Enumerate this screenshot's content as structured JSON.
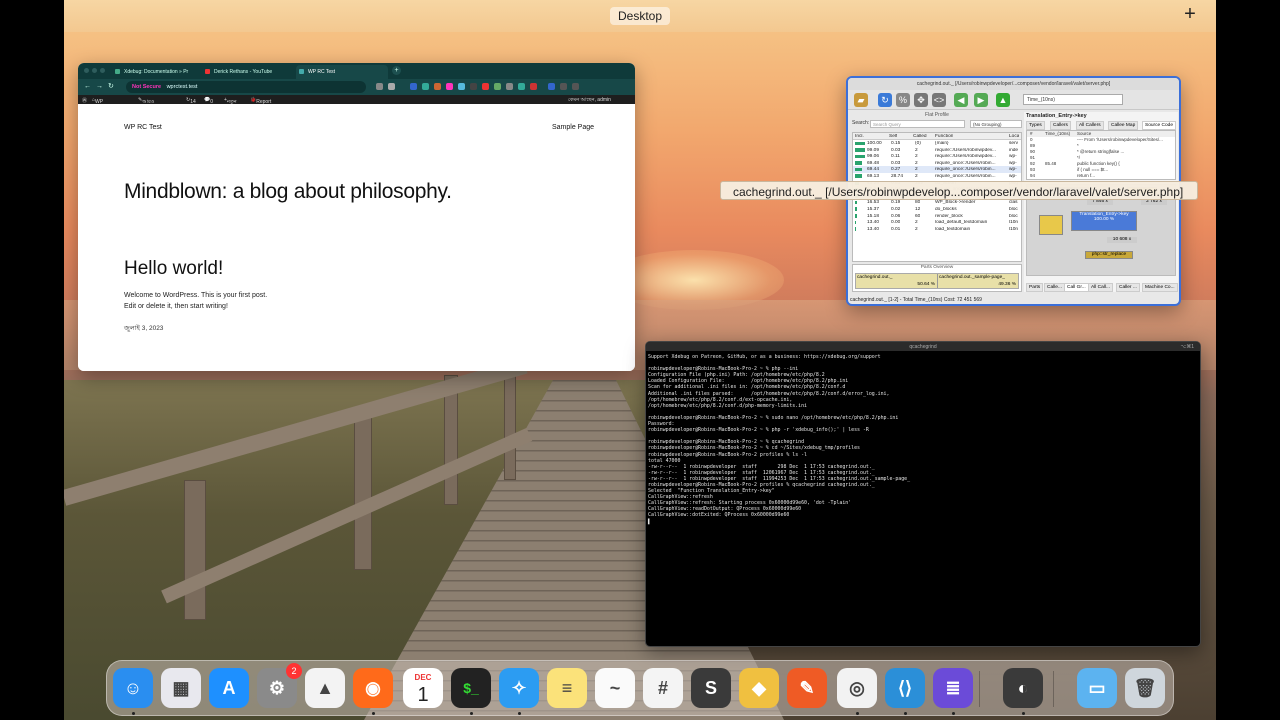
{
  "menubar": {
    "desktop_label": "Desktop",
    "plus_label": "+"
  },
  "browser": {
    "tabs": [
      {
        "label": "Xdebug: Documentation » Pr",
        "color": "#4a8"
      },
      {
        "label": "Derick Rethans - YouTube",
        "color": "#e33"
      },
      {
        "label": "WP RC Test",
        "color": "#4aa"
      }
    ],
    "new_tab": "+",
    "url_not_secure": "Not Secure",
    "url": "wprctest.test",
    "admin_bar": {
      "site": "WP RC Test",
      "customize": "আরও কাস্টমাইজ",
      "updates": "14",
      "comments": "0",
      "new": "নতুন",
      "report": "Report a Bug",
      "howdy": "কেমন আছেন, admin"
    },
    "page": {
      "site_title": "WP RC Test",
      "nav_link": "Sample Page",
      "hero": "Mindblown: a blog about philosophy.",
      "post_title": "Hello world!",
      "post_line1": "Welcome to WordPress. This is your first post.",
      "post_line2": "Edit or delete it, then start writing!",
      "post_date": "জুলাই 3, 2023"
    }
  },
  "kcachegrind": {
    "title": "cachegrind.out._ [/Users/robinwpdeveloper/...composer/vendor/laravel/valet/server.php]",
    "event_select": "Time_(10ns)",
    "flat_profile_label": "Flat Profile",
    "search_label": "Search:",
    "search_placeholder": "Search Query",
    "grouping": "(No Grouping)",
    "columns": [
      "Incl.",
      "Self",
      "Called",
      "Function",
      "Loca"
    ],
    "rows": [
      {
        "incl": "100.00",
        "self": "0.15",
        "called": "(0)",
        "fn": "{main}",
        "loc": "serv"
      },
      {
        "incl": "99.09",
        "self": "0.03",
        "called": "2",
        "fn": "require::/Users/robinwpdev...",
        "loc": "inde"
      },
      {
        "incl": "99.06",
        "self": "0.11",
        "called": "2",
        "fn": "require::/Users/robinwpdev...",
        "loc": "wp-"
      },
      {
        "incl": "69.48",
        "self": "0.03",
        "called": "2",
        "fn": "require_once::/Users/robin...",
        "loc": "wp-"
      },
      {
        "incl": "69.44",
        "self": "0.27",
        "called": "2",
        "fn": "require_once::/Users/robin...",
        "loc": "wp-"
      },
      {
        "incl": "69.13",
        "self": "28.74",
        "called": "2",
        "fn": "require_once::/Users/robin...",
        "loc": "wp-"
      },
      {
        "incl": "43.28",
        "self": "0.63",
        "called": "382",
        "fn": "do_action",
        "loc": "plug"
      },
      {
        "incl": "28.23",
        "self": "0.04",
        "called": "2",
        "fn": "require_once::/Users/robin...",
        "loc": "tem"
      },
      {
        "incl": "25.06",
        "self": "0.01",
        "called": "2",
        "fn": "include::/Users/robinwpdev...",
        "loc": "tem"
      },
      {
        "incl": "16.53",
        "self": "0.19",
        "called": "80",
        "fn": "WP_Block->render",
        "loc": "clas"
      },
      {
        "incl": "15.37",
        "self": "0.02",
        "called": "12",
        "fn": "do_blocks",
        "loc": "bloc"
      },
      {
        "incl": "15.18",
        "self": "0.06",
        "called": "60",
        "fn": "render_block",
        "loc": "bloc"
      },
      {
        "incl": "13.40",
        "self": "0.00",
        "called": "2",
        "fn": "load_default_textdomain",
        "loc": "l10n"
      },
      {
        "incl": "13.40",
        "self": "0.01",
        "called": "2",
        "fn": "load_textdomain",
        "loc": "l10n"
      }
    ],
    "right_title": "Translation_Entry->key",
    "right_tabs": [
      "Types",
      "Callers",
      "All Callers",
      "Callee Map",
      "Source Code"
    ],
    "src_columns": [
      "#",
      "Time_(10ns)",
      "Source"
    ],
    "src_rows": [
      {
        "n": "0",
        "t": "",
        "s": "---- From '/Users/robinwpdeveloper/Sites/..."
      },
      {
        "n": "89",
        "t": "",
        "s": "*"
      },
      {
        "n": "90",
        "t": "",
        "s": "* @return string|false ..."
      },
      {
        "n": "91",
        "t": "",
        "s": "*/"
      },
      {
        "n": "92",
        "t": "85.48",
        "s": "public function key() {"
      },
      {
        "n": "93",
        "t": "",
        "s": "if ( null === $t..."
      },
      {
        "n": "94",
        "t": "",
        "s": "return f..."
      }
    ],
    "graph": {
      "node_a": "72.78 %",
      "node_b": "22.22 %",
      "node_c": "7 846 x",
      "node_d": "2 762 x",
      "center": "Translation_Entry->key",
      "center_pct": "100.00 %",
      "node_e": "10 608 x",
      "node_f": "php::str_replace"
    },
    "bottom_tabs": [
      "Parts",
      "Calle...",
      "Call Gr...",
      "All Call...",
      "Caller ...",
      "Machine Co..."
    ],
    "parts_overview": "Parts Overview",
    "part1": "cachegrind.out._",
    "part1_pct": "50.64 %",
    "part2": "cachegrind.out._sample-page_",
    "part2_pct": "49.36 %",
    "status": "cachegrind.out._ [1-2] - Total Time_(10ns) Cost: 72 451 569"
  },
  "tooltip": "cachegrind.out._ [/Users/robinwpdevelop...composer/vendor/laravel/valet/server.php]",
  "terminal": {
    "title": "qcachegrind",
    "shortcut": "⌥⌘1",
    "lines": [
      "Support Xdebug on Patreon, GitHub, or as a business: https://xdebug.org/support",
      "",
      "robinwpdeveloper@Robins-MacBook-Pro-2 ~ % php --ini",
      "Configuration File (php.ini) Path: /opt/homebrew/etc/php/8.2",
      "Loaded Configuration File:         /opt/homebrew/etc/php/8.2/php.ini",
      "Scan for additional .ini files in: /opt/homebrew/etc/php/8.2/conf.d",
      "Additional .ini files parsed:      /opt/homebrew/etc/php/8.2/conf.d/error_log.ini,",
      "/opt/homebrew/etc/php/8.2/conf.d/ext-opcache.ini,",
      "/opt/homebrew/etc/php/8.2/conf.d/php-memory-limits.ini",
      "",
      "robinwpdeveloper@Robins-MacBook-Pro-2 ~ % sudo nano /opt/homebrew/etc/php/8.2/php.ini",
      "Password:",
      "robinwpdeveloper@Robins-MacBook-Pro-2 ~ % php -r 'xdebug_info();' | less -R",
      "",
      "robinwpdeveloper@Robins-MacBook-Pro-2 ~ % qcachegrind",
      "robinwpdeveloper@Robins-MacBook-Pro-2 ~ % cd ~/Sites/xdebug_tmp/profiles",
      "robinwpdeveloper@Robins-MacBook-Pro-2 profiles % ls -l",
      "total 47000",
      "-rw-r--r--  1 robinwpdeveloper  staff       298 Dec  1 17:53 cachegrind.out._",
      "-rw-r--r--  1 robinwpdeveloper  staff  12061967 Dec  1 17:53 cachegrind.out._",
      "-rw-r--r--  1 robinwpdeveloper  staff  11994253 Dec  1 17:53 cachegrind.out._sample-page_",
      "robinwpdeveloper@Robins-MacBook-Pro-2 profiles % qcachegrind cachegrind.out._",
      "Selected  \"Function Translation_Entry->key\"",
      "CallGraphView::refresh",
      "CallGraphView::refresh: Starting process 0x60000d99e60, 'dot -Tplain'",
      "CallGraphView::readDotOutput: QProcess 0x60000d99e60",
      "CallGraphView::dotExited: QProcess 0x60000d99e60",
      "▌"
    ]
  },
  "dock": {
    "badge": "2",
    "calendar_month": "DEC",
    "calendar_day": "1",
    "apps": [
      {
        "name": "finder-icon",
        "glyph": "☺",
        "color": "#2a8ef0"
      },
      {
        "name": "launchpad-icon",
        "glyph": "▦",
        "color": "#e8e8ee"
      },
      {
        "name": "app-store-icon",
        "glyph": "A",
        "color": "#1e90ff"
      },
      {
        "name": "system-settings-icon",
        "glyph": "⚙",
        "color": "#8a8a8a"
      },
      {
        "name": "google-drive-icon",
        "glyph": "▲",
        "color": "#f3f3f3"
      },
      {
        "name": "firefox-icon",
        "glyph": "◉",
        "color": "#ff6a1a"
      },
      {
        "name": "calendar-icon",
        "glyph": "",
        "color": "#ffffff"
      },
      {
        "name": "terminal-icon",
        "glyph": "$_",
        "color": "#222"
      },
      {
        "name": "safari-icon",
        "glyph": "✧",
        "color": "#2c9cf2"
      },
      {
        "name": "notes-icon",
        "glyph": "≡",
        "color": "#fbe27a"
      },
      {
        "name": "freeform-icon",
        "glyph": "~",
        "color": "#fafafa"
      },
      {
        "name": "slack-icon",
        "glyph": "#",
        "color": "#f4f4f4"
      },
      {
        "name": "sublime-text-icon",
        "glyph": "S",
        "color": "#3a3a3a"
      },
      {
        "name": "sequel-ace-icon",
        "glyph": "◆",
        "color": "#f0c040"
      },
      {
        "name": "postman-icon",
        "glyph": "✎",
        "color": "#ef5b25"
      },
      {
        "name": "chrome-icon",
        "glyph": "◎",
        "color": "#f2f2f2"
      },
      {
        "name": "vscode-icon",
        "glyph": "⟨⟩",
        "color": "#2b8fd8"
      },
      {
        "name": "database-icon",
        "glyph": "≣",
        "color": "#6b4bd8"
      },
      {
        "name": "qcachegrind-dock-icon",
        "glyph": "◐",
        "color": "#3a3a3a"
      },
      {
        "name": "downloads-folder-icon",
        "glyph": "▭",
        "color": "#5cb3f0"
      },
      {
        "name": "trash-icon",
        "glyph": "🗑",
        "color": "#cfd6dc"
      }
    ]
  }
}
